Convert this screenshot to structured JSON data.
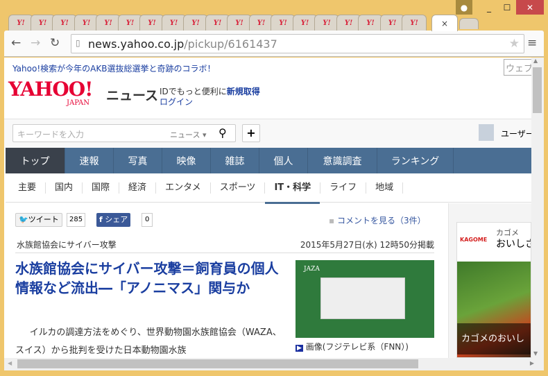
{
  "window": {
    "controls": {
      "profile": "profile-icon",
      "minimize": "_",
      "maximize": "☐",
      "close": "✕"
    }
  },
  "tabs": {
    "favicon": "Y!",
    "count": 19,
    "active_close": "×"
  },
  "toolbar": {
    "url_host": "news.yahoo.co.jp",
    "url_path": "/pickup/6161437"
  },
  "promo": {
    "text": "Yahoo!検索が今年のAKB選抜総選挙と奇跡のコラボ！",
    "search_stub": "ウェブ"
  },
  "header": {
    "logo": "YAHOO!",
    "logo_sub": "JAPAN",
    "service": "ニュース",
    "id_text": "IDでもっと便利に",
    "signup": "新規取得",
    "login": "ログイン"
  },
  "search": {
    "placeholder": "キーワードを入力",
    "scope": "ニュース",
    "plus": "+",
    "user": "ユーザー"
  },
  "nav": [
    "トップ",
    "速報",
    "写真",
    "映像",
    "雑誌",
    "個人",
    "意識調査",
    "ランキング"
  ],
  "subnav": [
    "主要",
    "国内",
    "国際",
    "経済",
    "エンタメ",
    "スポーツ",
    "IT・科学",
    "ライフ",
    "地域"
  ],
  "social": {
    "tweet": "ツイート",
    "tweet_count": "285",
    "share": "シェア",
    "share_count": "0",
    "comments": "コメントを見る（3件）"
  },
  "article": {
    "category": "水族館協会にサイバー攻撃",
    "date": "2015年5月27日(水) 12時50分掲載",
    "title": "水族館協会にサイバー攻撃＝飼育員の個人情報など流出―「アノニマス」関与か",
    "body": "イルカの調達方法をめぐり、世界動物園水族館協会（WAZA、スイス）から批判を受けた日本動物園水族",
    "image_caption": "画像(フジテレビ系（FNN）)",
    "image_logo": "JAZA"
  },
  "ad": {
    "brand": "カゴメ",
    "logo": "KAGOME",
    "headline": "おいしさ",
    "banner": "カゴメのおいし"
  }
}
